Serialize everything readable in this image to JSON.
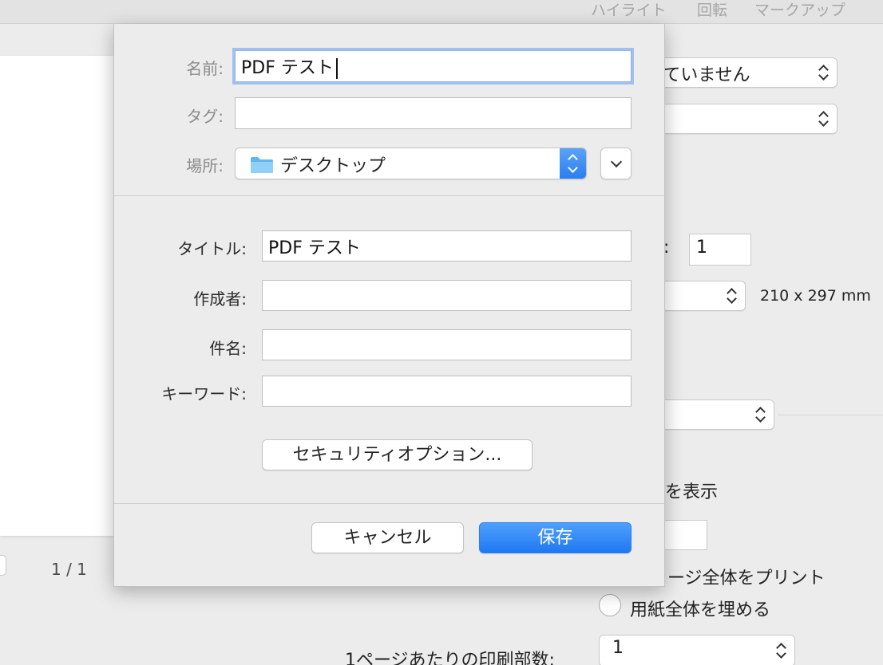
{
  "background": {
    "toolbar": {
      "highlight": "ハイライト",
      "rotate": "回転",
      "markup": "マークアップ"
    },
    "page_counter": "1 / 1",
    "printer_select": "れていません",
    "copies_value": "1",
    "paper_size": "210 x 297 mm",
    "show_label": "を表示",
    "print_page_option": "ージ全体をプリント",
    "fill_paper_option": "用紙全体を埋める",
    "copies_per_page_label": "1ページあたりの印刷部数:",
    "copies_per_page_value": "1"
  },
  "save_sheet": {
    "name_label": "名前:",
    "name_value": "PDF テスト",
    "tags_label": "タグ:",
    "tags_value": "",
    "location_label": "場所:",
    "location_value": "デスクトップ",
    "title_label": "タイトル:",
    "title_value": "PDF テスト",
    "author_label": "作成者:",
    "author_value": "",
    "subject_label": "件名:",
    "subject_value": "",
    "keywords_label": "キーワード:",
    "keywords_value": "",
    "security_button": "セキュリティオプション...",
    "cancel_button": "キャンセル",
    "save_button": "保存"
  },
  "colors": {
    "accent": "#2a7ff0",
    "focus_ring": "#9fc1f2",
    "sheet_bg": "#ececec"
  }
}
